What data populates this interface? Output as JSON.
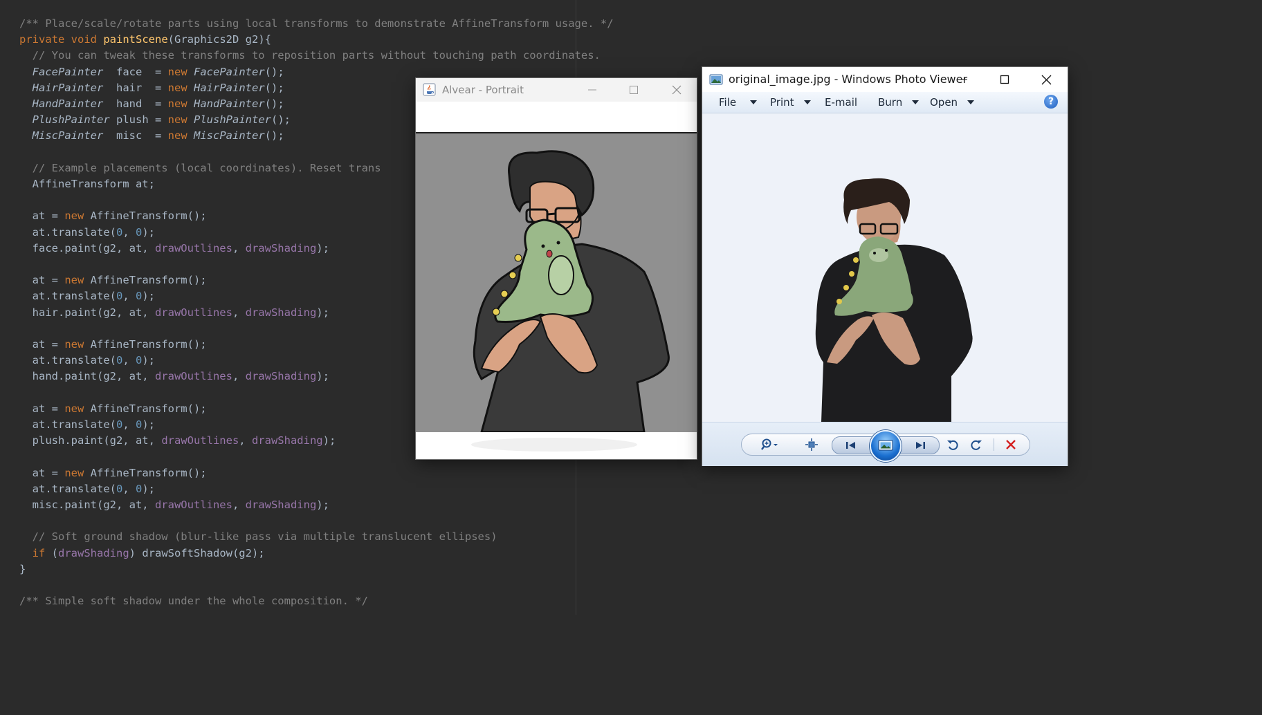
{
  "editor": {
    "lines": [
      "/** Place/scale/rotate parts using local transforms to demonstrate AffineTransform usage. */",
      "private void paintScene(Graphics2D g2){",
      "  // You can tweak these transforms to reposition parts without touching path coordinates.",
      "  FacePainter  face  = new FacePainter();",
      "  HairPainter  hair  = new HairPainter();",
      "  HandPainter  hand  = new HandPainter();",
      "  PlushPainter plush = new PlushPainter();",
      "  MiscPainter  misc  = new MiscPainter();",
      "",
      "  // Example placements (local coordinates). Reset trans",
      "  AffineTransform at;",
      "",
      "  at = new AffineTransform();",
      "  at.translate(0, 0);",
      "  face.paint(g2, at, drawOutlines, drawShading);",
      "",
      "  at = new AffineTransform();",
      "  at.translate(0, 0);",
      "  hair.paint(g2, at, drawOutlines, drawShading);",
      "",
      "  at = new AffineTransform();",
      "  at.translate(0, 0);",
      "  hand.paint(g2, at, drawOutlines, drawShading);",
      "",
      "  at = new AffineTransform();",
      "  at.translate(0, 0);",
      "  plush.paint(g2, at, drawOutlines, drawShading);",
      "",
      "  at = new AffineTransform();",
      "  at.translate(0, 0);",
      "  misc.paint(g2, at, drawOutlines, drawShading);",
      "",
      "  // Soft ground shadow (blur-like pass via multiple translucent ellipses)",
      "  if (drawShading) drawSoftShadow(g2);",
      "}",
      "",
      "/** Simple soft shadow under the whole composition. */"
    ]
  },
  "portrait_window": {
    "title": "Alvear - Portrait"
  },
  "photo_viewer": {
    "title": "original_image.jpg - Windows Photo Viewer",
    "menu": [
      "File",
      "Print",
      "E-mail",
      "Burn",
      "Open"
    ],
    "menu_has_dropdown": [
      true,
      true,
      false,
      true,
      true
    ],
    "help_label": "?"
  },
  "colors": {
    "editor_bg": "#2b2b2b",
    "keyword": "#cc7832",
    "method": "#ffc66d",
    "field": "#9876aa",
    "number": "#6897bb",
    "comment": "#808080",
    "delete_red": "#d42020"
  }
}
